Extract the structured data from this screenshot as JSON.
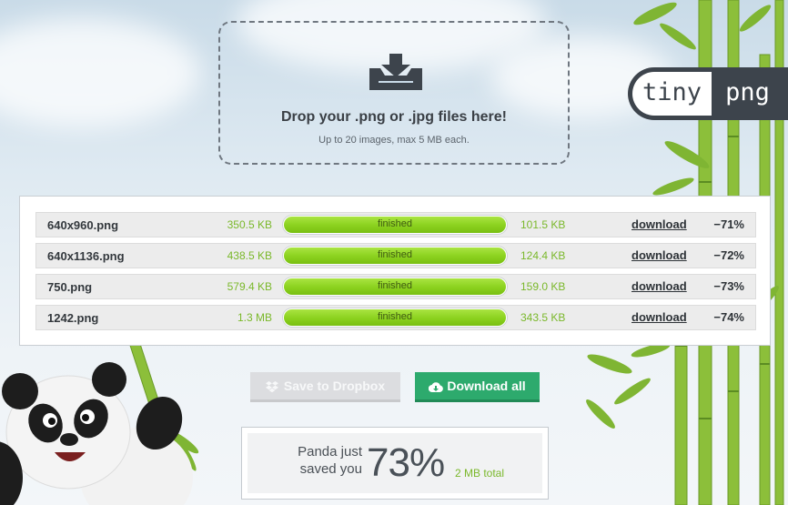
{
  "dropzone": {
    "title": "Drop your .png or .jpg files here!",
    "subtitle": "Up to 20 images, max 5 MB each."
  },
  "logo": {
    "left": "tiny",
    "right": "png"
  },
  "files": [
    {
      "name": "640x960.png",
      "original": "350.5 KB",
      "status": "finished",
      "progress": 1.0,
      "compressed": "101.5 KB",
      "download": "download",
      "savings": "−71%"
    },
    {
      "name": "640x1136.png",
      "original": "438.5 KB",
      "status": "finished",
      "progress": 1.0,
      "compressed": "124.4 KB",
      "download": "download",
      "savings": "−72%"
    },
    {
      "name": "750.png",
      "original": "579.4 KB",
      "status": "finished",
      "progress": 1.0,
      "compressed": "159.0 KB",
      "download": "download",
      "savings": "−73%"
    },
    {
      "name": "1242.png",
      "original": "1.3 MB",
      "status": "finished",
      "progress": 1.0,
      "compressed": "343.5 KB",
      "download": "download",
      "savings": "−74%"
    }
  ],
  "actions": {
    "dropbox_label": "Save to Dropbox",
    "download_all_label": "Download all"
  },
  "summary": {
    "label": "Panda just saved you",
    "percent": "73%",
    "total": "2 MB total"
  },
  "icons": {
    "upload": "download-tray-icon",
    "dropbox": "dropbox-icon",
    "download_all": "cloud-download-icon"
  },
  "colors": {
    "accent_green": "#7ab82a",
    "progress_green": "#8bd11e",
    "button_green": "#2daa6d",
    "dark": "#3d444c"
  }
}
